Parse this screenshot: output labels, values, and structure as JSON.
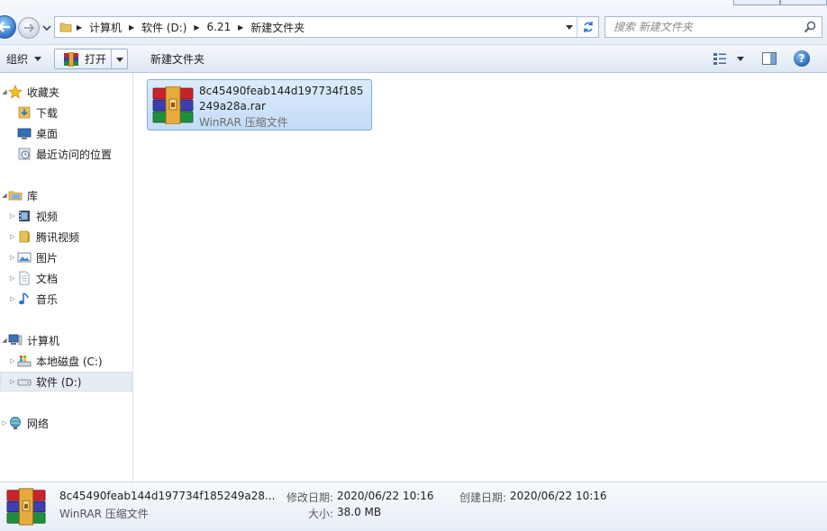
{
  "address": {
    "crumbs": [
      "计算机",
      "软件 (D:)",
      "6.21",
      "新建文件夹"
    ]
  },
  "search": {
    "placeholder": "搜索 新建文件夹"
  },
  "toolbar": {
    "organize": "组织",
    "open": "打开",
    "new_folder": "新建文件夹"
  },
  "nav": {
    "favorites": "收藏夹",
    "downloads": "下载",
    "desktop": "桌面",
    "recent": "最近访问的位置",
    "libraries": "库",
    "videos": "视频",
    "tencent_videos": "腾讯视频",
    "pictures": "图片",
    "documents": "文档",
    "music": "音乐",
    "computer": "计算机",
    "local_disk": "本地磁盘 (C:)",
    "software_disk": "软件 (D:)",
    "network": "网络"
  },
  "file": {
    "name": "8c45490feab144d197734f185249a28a.rar",
    "type": "WinRAR 压缩文件"
  },
  "details": {
    "name": "8c45490feab144d197734f185249a28...",
    "type": "WinRAR 压缩文件",
    "modified_label": "修改日期:",
    "modified_value": "2020/06/22 10:16",
    "created_label": "创建日期:",
    "created_value": "2020/06/22 10:16",
    "size_label": "大小:",
    "size_value": "38.0 MB"
  },
  "colors": {
    "selection": "#cde3fa",
    "selection_border": "#84acdd",
    "accent_blue": "#2b72c8"
  }
}
